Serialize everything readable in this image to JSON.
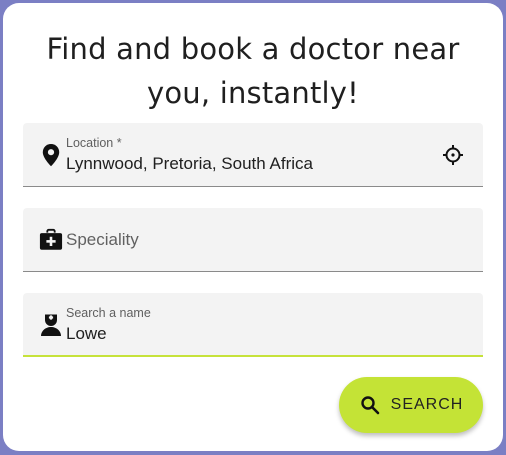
{
  "header": {
    "title_line1": "Find and book a doctor near",
    "title_line2": "you, instantly!"
  },
  "form": {
    "location": {
      "label": "Location *",
      "value": "Lynnwood, Pretoria, South Africa",
      "lead_icon": "location-pin-icon",
      "trail_icon": "my-location-crosshair-icon"
    },
    "speciality": {
      "placeholder": "Speciality",
      "lead_icon": "medical-bag-icon"
    },
    "name": {
      "label": "Search a name",
      "value": "Lowe",
      "lead_icon": "doctor-icon"
    }
  },
  "actions": {
    "search_label": "SEARCH",
    "search_icon": "search-icon"
  },
  "colors": {
    "background": "#7b7fc4",
    "accent": "#c4e336",
    "field_bg": "#f3f3f3"
  }
}
